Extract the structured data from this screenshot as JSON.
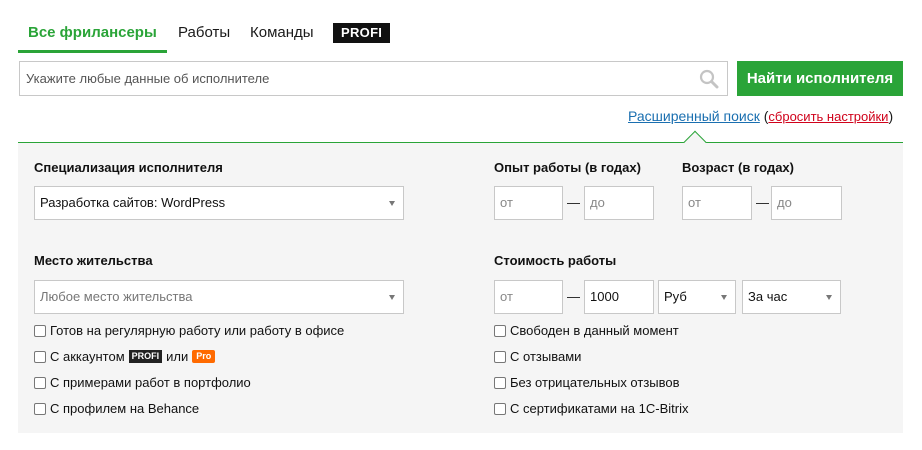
{
  "tabs": {
    "all_freelancers": "Все фрилансеры",
    "works": "Работы",
    "teams": "Команды",
    "profi": "PROFI"
  },
  "search": {
    "placeholder": "Укажите любые данные об исполнителе",
    "button": "Найти исполнителя"
  },
  "advanced": {
    "link": "Расширенный поиск",
    "open_paren": "(",
    "reset": "сбросить настройки",
    "close_paren": ")"
  },
  "filters": {
    "specialization": {
      "label": "Специализация исполнителя",
      "value": "Разработка сайтов: WordPress"
    },
    "experience": {
      "label": "Опыт работы (в годах)",
      "from_placeholder": "от",
      "to_placeholder": "до"
    },
    "age": {
      "label": "Возраст (в годах)",
      "from_placeholder": "от",
      "to_placeholder": "до"
    },
    "location": {
      "label": "Место жительства",
      "placeholder": "Любое место жительства"
    },
    "cost": {
      "label": "Стоимость работы",
      "from_placeholder": "от",
      "to_value": "1000",
      "currency": "Руб",
      "period": "За час"
    },
    "dash": "—"
  },
  "checkboxes_left": [
    "Готов на регулярную работу или работу в офисе",
    "С аккаунтом",
    "С примерами работ в портфолио",
    "С профилем на Behance"
  ],
  "account_badges": {
    "profi": "PROFI",
    "or": "или",
    "pro": "Pro"
  },
  "checkboxes_right": [
    "Свободен в данный момент",
    "С отзывами",
    "Без отрицательных отзывов",
    "С сертификатами на 1С-Bitrix"
  ],
  "colors": {
    "accent": "#2aa438",
    "link": "#1a6fb0",
    "reset": "#d0021b",
    "pro_badge": "#ff6a00"
  }
}
